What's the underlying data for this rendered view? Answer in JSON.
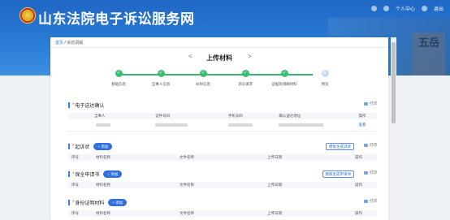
{
  "header": {
    "site_title": "山东法院电子诉讼服务网",
    "personal_center": "个人中心",
    "logout": "退出",
    "mountain_text": "五岳"
  },
  "breadcrumb": {
    "home": "首页",
    "separator": "/",
    "current": "诉前调解"
  },
  "page_title": "上传材料",
  "steps": [
    {
      "label": "基础信息",
      "status": "done"
    },
    {
      "label": "当事人信息",
      "status": "done"
    },
    {
      "label": "纠纷信息",
      "status": "done"
    },
    {
      "label": "诉讼请求",
      "status": "done"
    },
    {
      "label": "证据及调解材料",
      "status": "done"
    },
    {
      "label": "预览",
      "status": "todo",
      "number": "6"
    }
  ],
  "sections": {
    "service": {
      "title": "电子送达确认",
      "print": "打印",
      "columns": [
        "当事人",
        "证件号码",
        "手机号码",
        "确认送达地址",
        "操作"
      ],
      "row_action": "查看"
    },
    "complaint": {
      "title": "起诉状",
      "add": "+ 添加",
      "generate": "模板生成诉状",
      "print": "打印",
      "columns": [
        "序号",
        "材料名称",
        "文件名称",
        "上传日期",
        "操作"
      ]
    },
    "preservation": {
      "title": "保全申请书",
      "add": "+ 添加",
      "generate": "模板生成申请书",
      "print": "打印",
      "columns": [
        "序号",
        "材料名称",
        "文件名称",
        "上传日期",
        "操作"
      ]
    },
    "identity": {
      "title": "身份证明材料",
      "add": "+ 添加",
      "print": "打印",
      "columns": [
        "序号",
        "材料名称",
        "文件名称",
        "上传日期",
        "操作"
      ]
    }
  }
}
